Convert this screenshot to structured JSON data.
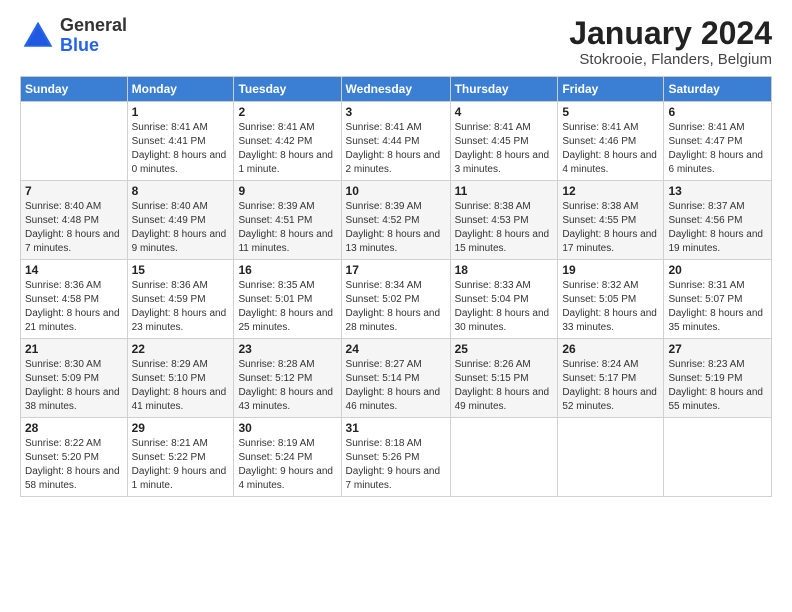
{
  "logo": {
    "general": "General",
    "blue": "Blue"
  },
  "title": "January 2024",
  "location": "Stokrooie, Flanders, Belgium",
  "days_of_week": [
    "Sunday",
    "Monday",
    "Tuesday",
    "Wednesday",
    "Thursday",
    "Friday",
    "Saturday"
  ],
  "weeks": [
    [
      {
        "day": "",
        "sunrise": "",
        "sunset": "",
        "daylight": ""
      },
      {
        "day": "1",
        "sunrise": "Sunrise: 8:41 AM",
        "sunset": "Sunset: 4:41 PM",
        "daylight": "Daylight: 8 hours and 0 minutes."
      },
      {
        "day": "2",
        "sunrise": "Sunrise: 8:41 AM",
        "sunset": "Sunset: 4:42 PM",
        "daylight": "Daylight: 8 hours and 1 minute."
      },
      {
        "day": "3",
        "sunrise": "Sunrise: 8:41 AM",
        "sunset": "Sunset: 4:44 PM",
        "daylight": "Daylight: 8 hours and 2 minutes."
      },
      {
        "day": "4",
        "sunrise": "Sunrise: 8:41 AM",
        "sunset": "Sunset: 4:45 PM",
        "daylight": "Daylight: 8 hours and 3 minutes."
      },
      {
        "day": "5",
        "sunrise": "Sunrise: 8:41 AM",
        "sunset": "Sunset: 4:46 PM",
        "daylight": "Daylight: 8 hours and 4 minutes."
      },
      {
        "day": "6",
        "sunrise": "Sunrise: 8:41 AM",
        "sunset": "Sunset: 4:47 PM",
        "daylight": "Daylight: 8 hours and 6 minutes."
      }
    ],
    [
      {
        "day": "7",
        "sunrise": "Sunrise: 8:40 AM",
        "sunset": "Sunset: 4:48 PM",
        "daylight": "Daylight: 8 hours and 7 minutes."
      },
      {
        "day": "8",
        "sunrise": "Sunrise: 8:40 AM",
        "sunset": "Sunset: 4:49 PM",
        "daylight": "Daylight: 8 hours and 9 minutes."
      },
      {
        "day": "9",
        "sunrise": "Sunrise: 8:39 AM",
        "sunset": "Sunset: 4:51 PM",
        "daylight": "Daylight: 8 hours and 11 minutes."
      },
      {
        "day": "10",
        "sunrise": "Sunrise: 8:39 AM",
        "sunset": "Sunset: 4:52 PM",
        "daylight": "Daylight: 8 hours and 13 minutes."
      },
      {
        "day": "11",
        "sunrise": "Sunrise: 8:38 AM",
        "sunset": "Sunset: 4:53 PM",
        "daylight": "Daylight: 8 hours and 15 minutes."
      },
      {
        "day": "12",
        "sunrise": "Sunrise: 8:38 AM",
        "sunset": "Sunset: 4:55 PM",
        "daylight": "Daylight: 8 hours and 17 minutes."
      },
      {
        "day": "13",
        "sunrise": "Sunrise: 8:37 AM",
        "sunset": "Sunset: 4:56 PM",
        "daylight": "Daylight: 8 hours and 19 minutes."
      }
    ],
    [
      {
        "day": "14",
        "sunrise": "Sunrise: 8:36 AM",
        "sunset": "Sunset: 4:58 PM",
        "daylight": "Daylight: 8 hours and 21 minutes."
      },
      {
        "day": "15",
        "sunrise": "Sunrise: 8:36 AM",
        "sunset": "Sunset: 4:59 PM",
        "daylight": "Daylight: 8 hours and 23 minutes."
      },
      {
        "day": "16",
        "sunrise": "Sunrise: 8:35 AM",
        "sunset": "Sunset: 5:01 PM",
        "daylight": "Daylight: 8 hours and 25 minutes."
      },
      {
        "day": "17",
        "sunrise": "Sunrise: 8:34 AM",
        "sunset": "Sunset: 5:02 PM",
        "daylight": "Daylight: 8 hours and 28 minutes."
      },
      {
        "day": "18",
        "sunrise": "Sunrise: 8:33 AM",
        "sunset": "Sunset: 5:04 PM",
        "daylight": "Daylight: 8 hours and 30 minutes."
      },
      {
        "day": "19",
        "sunrise": "Sunrise: 8:32 AM",
        "sunset": "Sunset: 5:05 PM",
        "daylight": "Daylight: 8 hours and 33 minutes."
      },
      {
        "day": "20",
        "sunrise": "Sunrise: 8:31 AM",
        "sunset": "Sunset: 5:07 PM",
        "daylight": "Daylight: 8 hours and 35 minutes."
      }
    ],
    [
      {
        "day": "21",
        "sunrise": "Sunrise: 8:30 AM",
        "sunset": "Sunset: 5:09 PM",
        "daylight": "Daylight: 8 hours and 38 minutes."
      },
      {
        "day": "22",
        "sunrise": "Sunrise: 8:29 AM",
        "sunset": "Sunset: 5:10 PM",
        "daylight": "Daylight: 8 hours and 41 minutes."
      },
      {
        "day": "23",
        "sunrise": "Sunrise: 8:28 AM",
        "sunset": "Sunset: 5:12 PM",
        "daylight": "Daylight: 8 hours and 43 minutes."
      },
      {
        "day": "24",
        "sunrise": "Sunrise: 8:27 AM",
        "sunset": "Sunset: 5:14 PM",
        "daylight": "Daylight: 8 hours and 46 minutes."
      },
      {
        "day": "25",
        "sunrise": "Sunrise: 8:26 AM",
        "sunset": "Sunset: 5:15 PM",
        "daylight": "Daylight: 8 hours and 49 minutes."
      },
      {
        "day": "26",
        "sunrise": "Sunrise: 8:24 AM",
        "sunset": "Sunset: 5:17 PM",
        "daylight": "Daylight: 8 hours and 52 minutes."
      },
      {
        "day": "27",
        "sunrise": "Sunrise: 8:23 AM",
        "sunset": "Sunset: 5:19 PM",
        "daylight": "Daylight: 8 hours and 55 minutes."
      }
    ],
    [
      {
        "day": "28",
        "sunrise": "Sunrise: 8:22 AM",
        "sunset": "Sunset: 5:20 PM",
        "daylight": "Daylight: 8 hours and 58 minutes."
      },
      {
        "day": "29",
        "sunrise": "Sunrise: 8:21 AM",
        "sunset": "Sunset: 5:22 PM",
        "daylight": "Daylight: 9 hours and 1 minute."
      },
      {
        "day": "30",
        "sunrise": "Sunrise: 8:19 AM",
        "sunset": "Sunset: 5:24 PM",
        "daylight": "Daylight: 9 hours and 4 minutes."
      },
      {
        "day": "31",
        "sunrise": "Sunrise: 8:18 AM",
        "sunset": "Sunset: 5:26 PM",
        "daylight": "Daylight: 9 hours and 7 minutes."
      },
      {
        "day": "",
        "sunrise": "",
        "sunset": "",
        "daylight": ""
      },
      {
        "day": "",
        "sunrise": "",
        "sunset": "",
        "daylight": ""
      },
      {
        "day": "",
        "sunrise": "",
        "sunset": "",
        "daylight": ""
      }
    ]
  ]
}
